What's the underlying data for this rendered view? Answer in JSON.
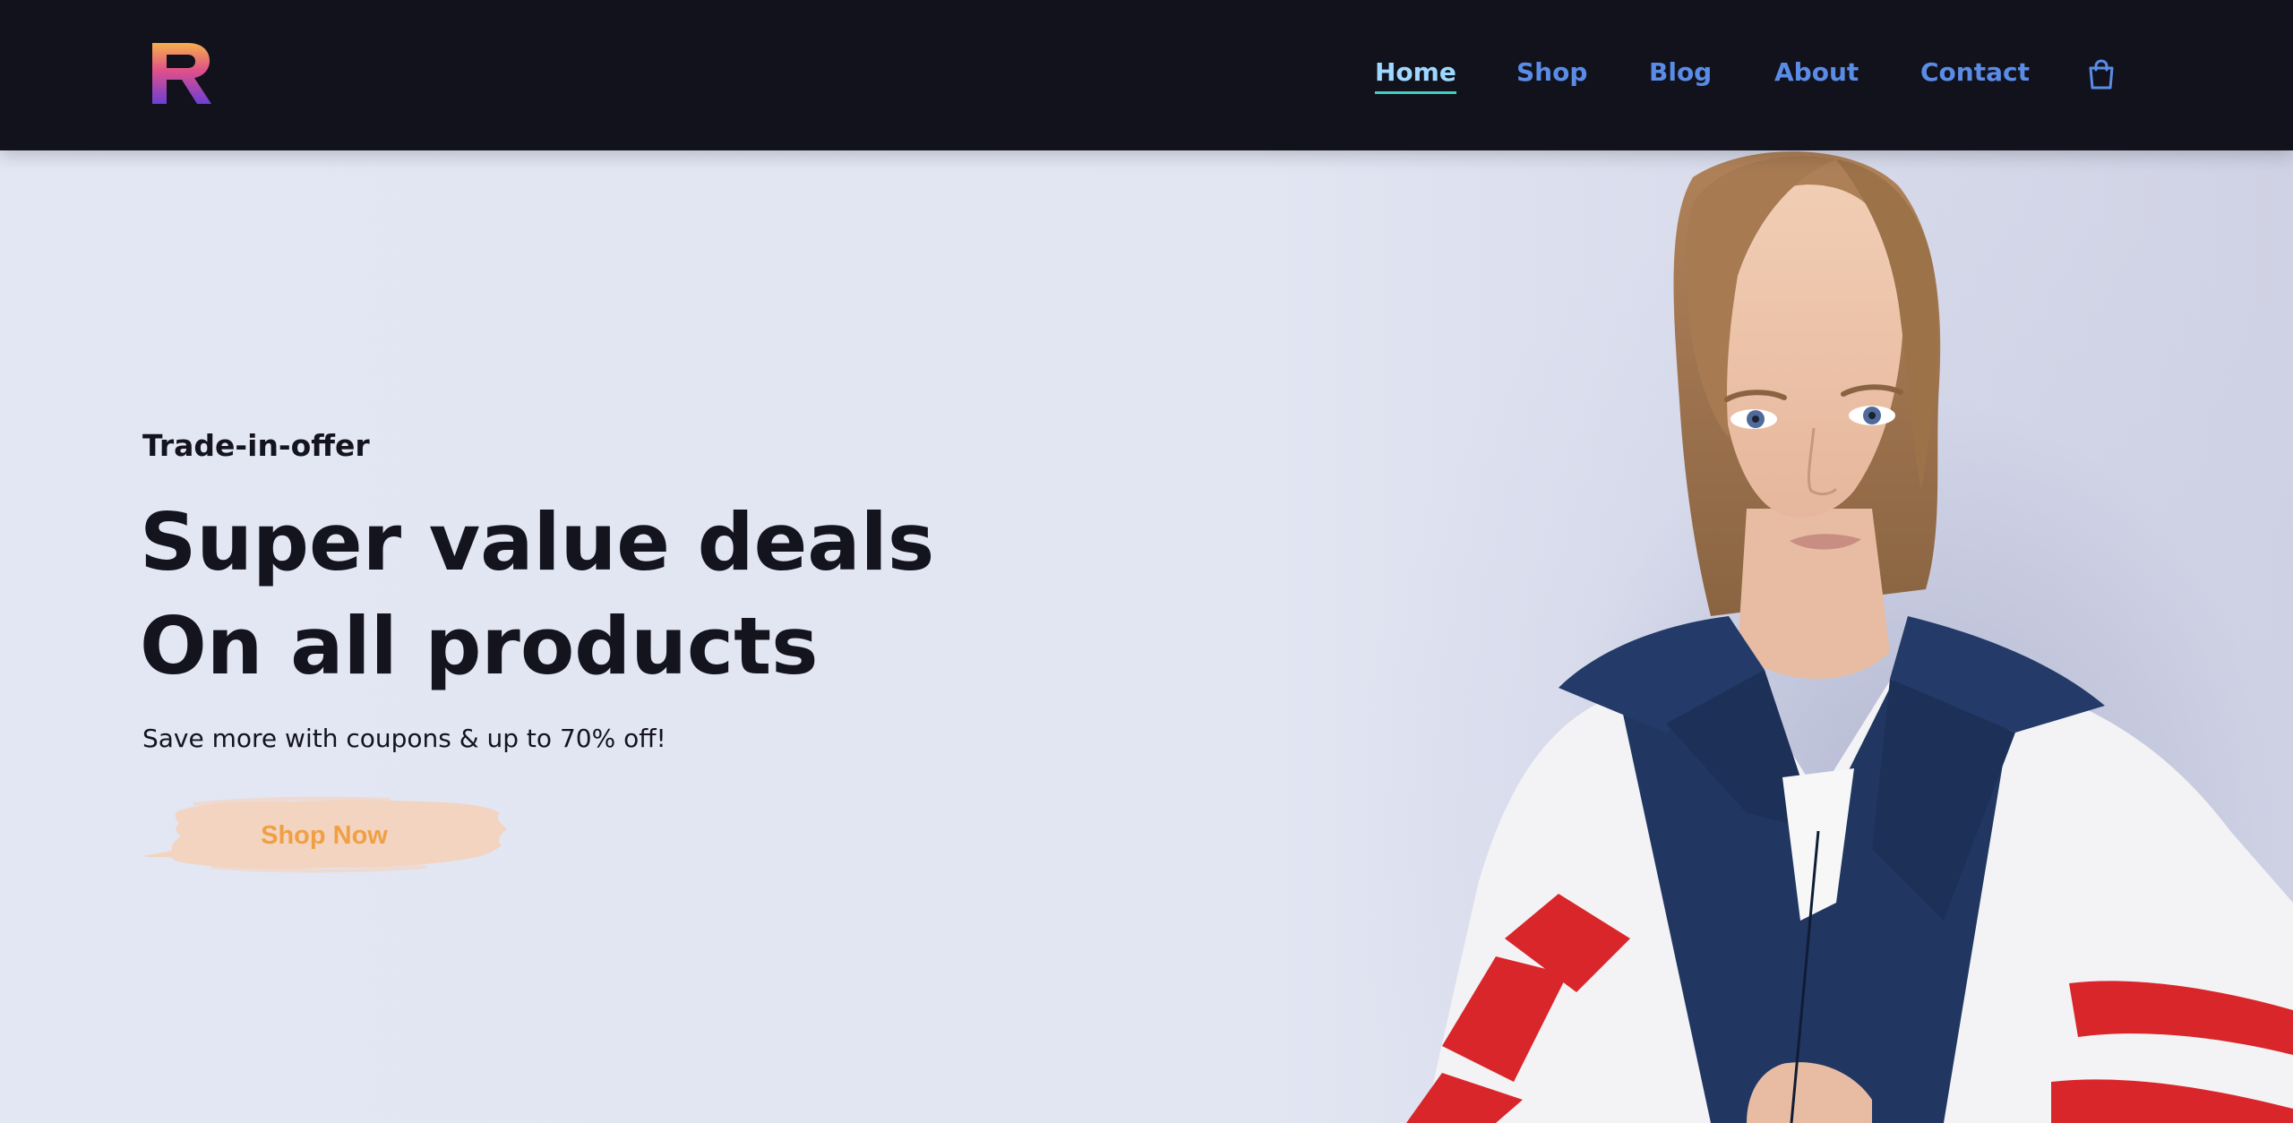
{
  "header": {
    "logo_icon": "r-logo-icon",
    "nav": [
      {
        "label": "Home",
        "active": true
      },
      {
        "label": "Shop",
        "active": false
      },
      {
        "label": "Blog",
        "active": false
      },
      {
        "label": "About",
        "active": false
      },
      {
        "label": "Contact",
        "active": false
      }
    ],
    "cart_icon": "shopping-bag-icon"
  },
  "hero": {
    "kicker": "Trade-in-offer",
    "headline_line1": "Super value deals",
    "headline_line2": "On all products",
    "subtext": "Save more with coupons & up to 70% off!",
    "cta_label": "Shop Now"
  },
  "colors": {
    "header_bg": "#12121c",
    "nav_link": "#5a8ce6",
    "nav_active": "#9ed8ff",
    "hero_bg": "#e3e6f3",
    "cta_brush": "#f2d4c1",
    "cta_text": "#f0a043"
  }
}
